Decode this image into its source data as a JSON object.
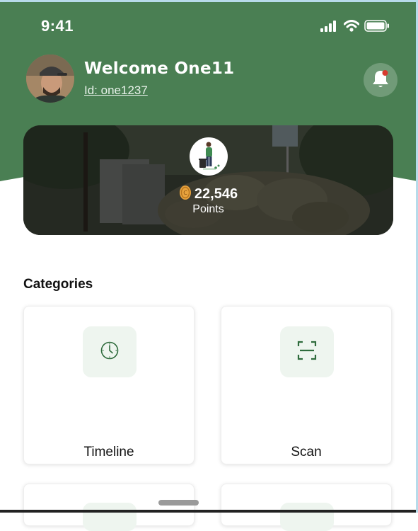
{
  "colors": {
    "primary": "#4a7f53",
    "icon_bg": "#eef5ef",
    "accent": "#e8a33d"
  },
  "status_bar": {
    "time": "9:41",
    "icons": [
      "signal-icon",
      "wifi-icon",
      "battery-icon"
    ]
  },
  "profile": {
    "welcome": "Welcome One11",
    "id_text": "Id: one1237"
  },
  "points": {
    "value": "22,546",
    "label": "Points",
    "coin_icon": "coin-icon",
    "badge_icon": "recycling-person-icon"
  },
  "categories": {
    "title": "Categories",
    "items": [
      {
        "label": "Timeline",
        "icon": "clock-icon"
      },
      {
        "label": "Scan",
        "icon": "scan-icon"
      }
    ]
  }
}
